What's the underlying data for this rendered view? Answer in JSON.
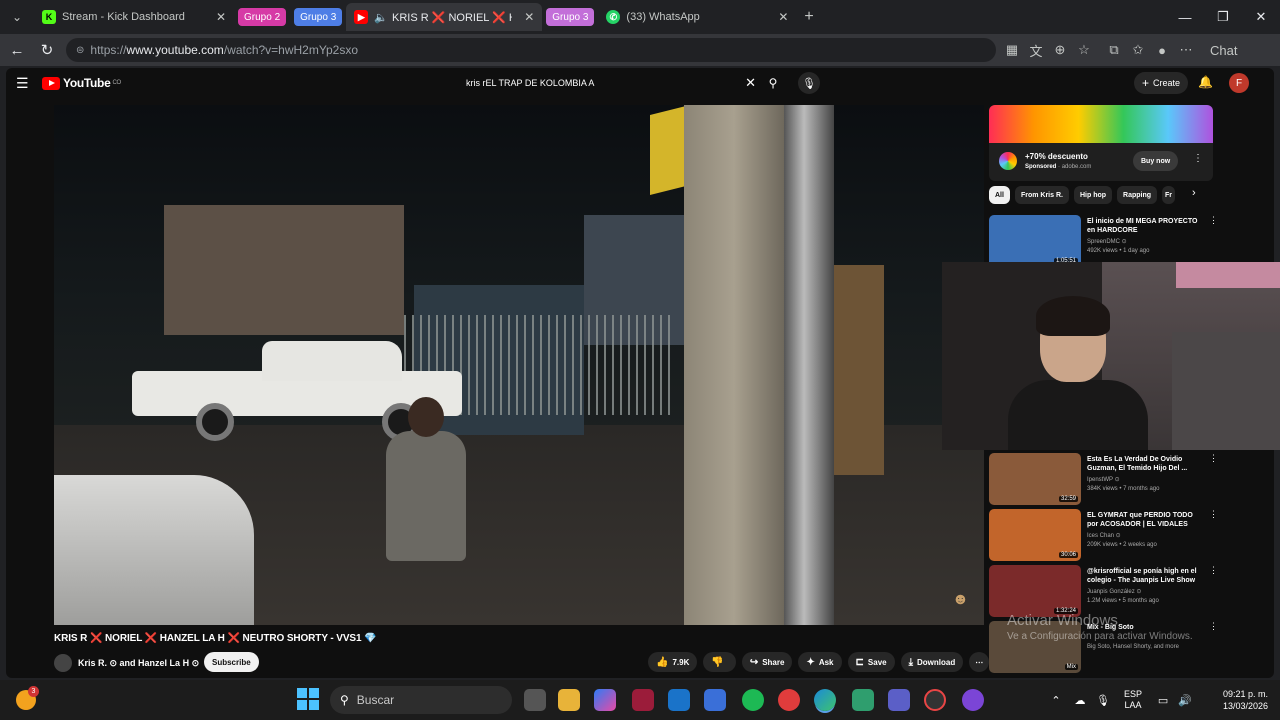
{
  "browser": {
    "tabs": [
      {
        "label": "Stream - Kick Dashboard",
        "favicon": "kick-icon",
        "color": "#53fc18"
      },
      {
        "label": "KRIS R ❌ NORIEL ❌ HANZE",
        "favicon": "youtube-icon",
        "color": "#ff0000"
      },
      {
        "label": "(33) WhatsApp",
        "favicon": "whatsapp-icon",
        "color": "#25d366"
      }
    ],
    "groups": [
      {
        "label": "Grupo 2",
        "color": "#d63aa6"
      },
      {
        "label": "Grupo 3",
        "color": "#4e7ee6"
      },
      {
        "label": "Grupo 3",
        "color": "#c36fd9"
      }
    ],
    "url_prefix": "https://",
    "url_host": "www.youtube.com",
    "url_path": "/watch?v=hwH2mYp2sxo",
    "chat_label": "Chat"
  },
  "youtube": {
    "logo_text": "YouTube",
    "logo_sup": "CO",
    "search_value": "kris rEL TRAP DE KOLOMBIA A",
    "create_label": "Create",
    "avatar_letter": "F",
    "video": {
      "title_parts": [
        "KRIS R",
        "❌",
        "NORIEL",
        "❌",
        "HANZEL LA H",
        "❌",
        "NEUTRO SHORTY - VVS1",
        "💎"
      ],
      "channel": "Kris R. ⊙ and Hanzel La H ⊙",
      "subscribe_label": "Subscribe",
      "likes": "7.9K",
      "share_label": "Share",
      "ask_label": "Ask",
      "save_label": "Save",
      "download_label": "Download"
    },
    "ad": {
      "title": "+70% descuento",
      "sponsor_label": "Sponsored",
      "sponsor_domain": "adobe.com",
      "button_label": "Buy now"
    },
    "chips": [
      "All",
      "From Kris R.",
      "Hip hop",
      "Rapping",
      "Fr"
    ],
    "recommendations": [
      {
        "title": "El inicio de MI MEGA PROYECTO en HARDCORE",
        "channel": "SpreenDMC ⊙",
        "meta": "492K views • 1 day ago",
        "duration": "1:05:51",
        "thumb_color": "#3a6fb5"
      },
      {
        "title": "Esta Es La Verdad De Ovidio Guzman, El Temido Hijo Del ...",
        "channel": "IpenstWP ⊙",
        "meta": "384K views • 7 months ago",
        "duration": "32:59",
        "thumb_color": "#8a5a3a"
      },
      {
        "title": "EL GYMRAT que PERDIO TODO por ACOSADOR | EL VIDALES",
        "channel": "Ices Chan ⊙",
        "meta": "209K views • 2 weeks ago",
        "duration": "30:06",
        "thumb_color": "#c2652b"
      },
      {
        "title": "@krisrofficial se ponía high en el colegio - The Juanpis Live Show",
        "channel": "Juanpis González ⊙",
        "meta": "1.2M views • 5 months ago",
        "duration": "1:32:24",
        "thumb_color": "#7b2a2a"
      },
      {
        "title": "Mix - Big Soto",
        "channel": "Big Soto, Hansel Shorty, and more",
        "meta": "",
        "duration": "Mix",
        "thumb_color": "#5a4a3a"
      }
    ]
  },
  "watermark": {
    "line1": "Activar Windows",
    "line2": "Ve a Configuración para activar Windows."
  },
  "taskbar": {
    "weather_badge": "3",
    "search_placeholder": "Buscar",
    "lang_top": "ESP",
    "lang_bottom": "LAA",
    "time": "09:21 p. m.",
    "date": "13/03/2026"
  }
}
